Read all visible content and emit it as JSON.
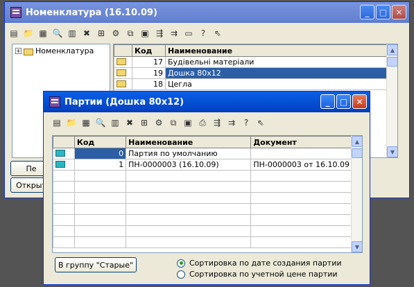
{
  "back_window": {
    "title": "Номенклатура (16.10.09)",
    "tree": {
      "root_label": "Номенклатура",
      "expander": "+"
    },
    "grid": {
      "columns": [
        "",
        "Код",
        "Наименование"
      ],
      "rows": [
        {
          "code": "17",
          "name": "Будівельні матеріали",
          "icon": "folder-icon"
        },
        {
          "code": "19",
          "name": "Дошка 80х12",
          "icon": "folder-icon"
        },
        {
          "code": "18",
          "name": "Цегла",
          "icon": "folder-icon"
        }
      ]
    },
    "left_buttons": [
      "Пе",
      "Открыт"
    ]
  },
  "front_window": {
    "title": "Партии (Дошка 80х12)",
    "grid": {
      "columns": [
        "",
        "Код",
        "Наименование",
        "Документ"
      ],
      "rows": [
        {
          "code": "0",
          "name": "Партия по умолчанию",
          "doc": ""
        },
        {
          "code": "1",
          "name": "ПН-0000003 (16.10.09)",
          "doc": "ПН-0000003 от 16.10.09"
        }
      ]
    },
    "group_button": "В группу \"Старые\"",
    "sort_options": [
      "Сортировка по дате создания партии",
      "Сортировка по учетной цене партии"
    ],
    "sort_selected": 0
  },
  "colors": {
    "title_active": "#0653d6",
    "title_inactive": "#6f8ad6",
    "selection": "#2c5ea5",
    "desktop": "#545454"
  }
}
